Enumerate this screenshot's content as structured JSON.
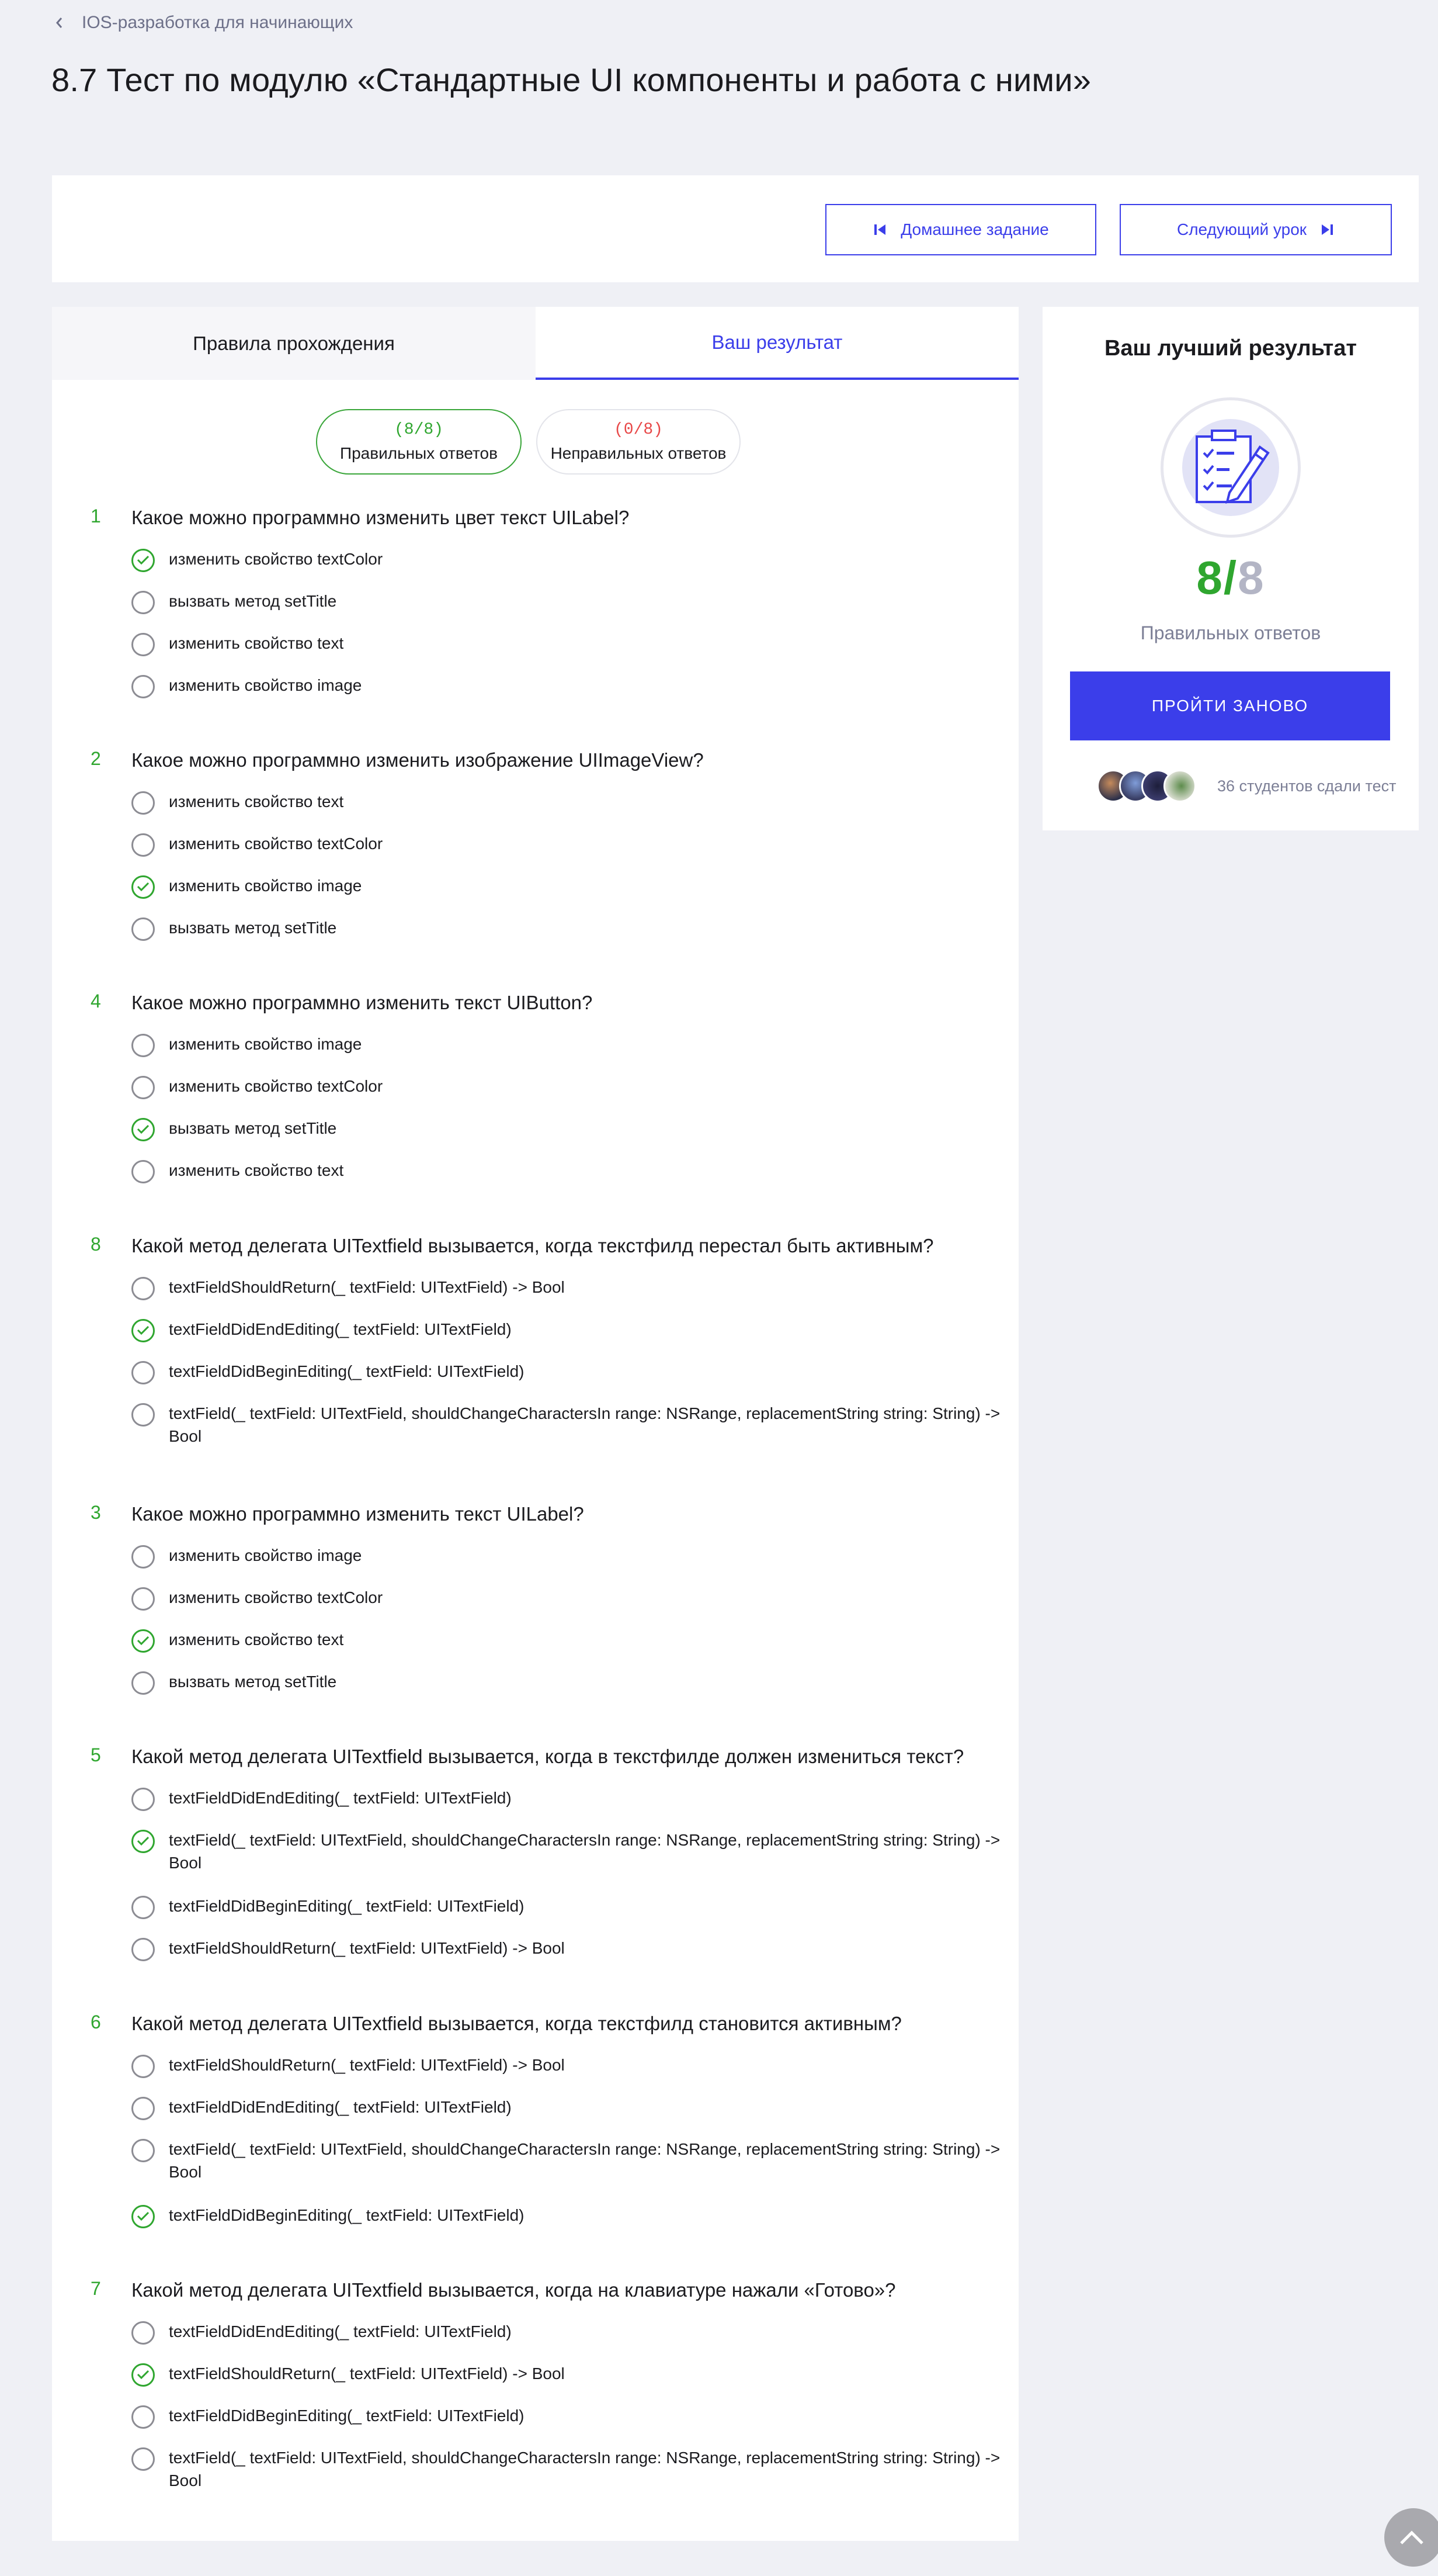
{
  "breadcrumb": {
    "label": "IOS-разработка для начинающих"
  },
  "page_title": "8.7 Тест по модулю «Стандартные UI компоненты и работа с ними»",
  "nav": {
    "prev_label": "Домашнее задание",
    "next_label": "Следующий урок"
  },
  "tabs": {
    "rules": "Правила прохождения",
    "result": "Ваш результат"
  },
  "summary": {
    "correct_count": "(8/8)",
    "correct_label": "Правильных ответов",
    "wrong_count": "(0/8)",
    "wrong_label": "Неправильных ответов"
  },
  "questions": [
    {
      "num": "1",
      "text": "Какое можно программно изменить цвет текст UILabel?",
      "options": [
        "изменить свойство textColor",
        "вызвать метод setTitle",
        "изменить свойство text",
        "изменить свойство image"
      ],
      "correct": 0
    },
    {
      "num": "2",
      "text": "Какое можно программно изменить изображение UIImageView?",
      "options": [
        "изменить свойство text",
        "изменить свойство textColor",
        "изменить свойство image",
        "вызвать метод setTitle"
      ],
      "correct": 2
    },
    {
      "num": "4",
      "text": "Какое можно программно изменить текст UIButton?",
      "options": [
        "изменить свойство image",
        "изменить свойство textColor",
        "вызвать метод setTitle",
        "изменить свойство text"
      ],
      "correct": 2
    },
    {
      "num": "8",
      "text": "Какой метод делегата UITextfield вызывается, когда текстфилд перестал быть активным?",
      "options": [
        "textFieldShouldReturn(_ textField: UITextField) -> Bool",
        "textFieldDidEndEditing(_ textField: UITextField)",
        "textFieldDidBeginEditing(_ textField: UITextField)",
        "textField(_ textField: UITextField, shouldChangeCharactersIn range: NSRange, replacementString string: String) -> Bool"
      ],
      "correct": 1
    },
    {
      "num": "3",
      "text": "Какое можно программно изменить текст UILabel?",
      "options": [
        "изменить свойство image",
        "изменить свойство textColor",
        "изменить свойство text",
        "вызвать метод setTitle"
      ],
      "correct": 2
    },
    {
      "num": "5",
      "text": "Какой метод делегата UITextfield вызывается, когда в текстфилде должен измениться текст?",
      "options": [
        "textFieldDidEndEditing(_ textField: UITextField)",
        "textField(_ textField: UITextField, shouldChangeCharactersIn range: NSRange, replacementString string: String) -> Bool",
        "textFieldDidBeginEditing(_ textField: UITextField)",
        "textFieldShouldReturn(_ textField: UITextField) -> Bool"
      ],
      "correct": 1
    },
    {
      "num": "6",
      "text": "Какой метод делегата UITextfield вызывается, когда текстфилд становится активным?",
      "options": [
        "textFieldShouldReturn(_ textField: UITextField) -> Bool",
        "textFieldDidEndEditing(_ textField: UITextField)",
        "textField(_ textField: UITextField, shouldChangeCharactersIn range: NSRange, replacementString string: String) -> Bool",
        "textFieldDidBeginEditing(_ textField: UITextField)"
      ],
      "correct": 3
    },
    {
      "num": "7",
      "text": "Какой метод делегата UITextfield вызывается, когда на клавиатуре нажали «Готово»?",
      "options": [
        "textFieldDidEndEditing(_ textField: UITextField)",
        "textFieldShouldReturn(_ textField: UITextField) -> Bool",
        "textFieldDidBeginEditing(_ textField: UITextField)",
        "textField(_ textField: UITextField, shouldChangeCharactersIn range: NSRange, replacementString string: String) -> Bool"
      ],
      "correct": 1
    }
  ],
  "best": {
    "title": "Ваш лучший результат",
    "score": "8",
    "slash": "/",
    "total": "8",
    "label": "Правильных ответов",
    "retry_label": "ПРОЙТИ ЗАНОВО",
    "students_text": "36 студентов сдали тест"
  },
  "colors": {
    "accent": "#3b3eea",
    "correct": "#2fa62f",
    "wrong": "#e84848",
    "background": "#eff0f5"
  },
  "icons": [
    "chevron-left-icon",
    "skip-back-icon",
    "skip-forward-icon",
    "check-icon",
    "checklist-pencil-icon",
    "chevron-up-icon"
  ]
}
